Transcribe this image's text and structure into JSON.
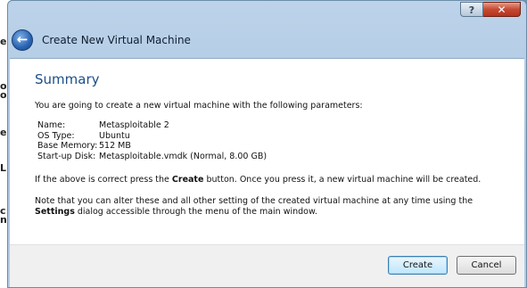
{
  "background": {
    "strip_letters": [
      "e",
      "o",
      "o",
      "e",
      "L",
      "c",
      "n"
    ]
  },
  "window": {
    "title": "Create New Virtual Machine",
    "help_label": "?",
    "close_label": "✕",
    "back_icon": "back-arrow-icon"
  },
  "summary": {
    "heading": "Summary",
    "intro": "You are going to create a new virtual machine with the following parameters:",
    "params": [
      {
        "label": "Name:",
        "value": "Metasploitable 2"
      },
      {
        "label": "OS Type:",
        "value": "Ubuntu"
      },
      {
        "label": "Base Memory:",
        "value": "512 MB"
      },
      {
        "label": "Start-up Disk:",
        "value": "Metasploitable.vmdk (Normal, 8.00 GB)"
      }
    ],
    "confirm_pre": "If the above is correct press the ",
    "confirm_bold": "Create",
    "confirm_post": " button. Once you press it, a new virtual machine will be created.",
    "note_pre": "Note that you can alter these and all other setting of the created virtual machine at any time using the ",
    "note_bold": "Settings",
    "note_post": " dialog accessible through the menu of the main window."
  },
  "footer": {
    "create_label": "Create",
    "cancel_label": "Cancel"
  },
  "colors": {
    "heading": "#1b4f88",
    "close_button": "#c54a32",
    "default_button_border": "#3c7fb1"
  }
}
